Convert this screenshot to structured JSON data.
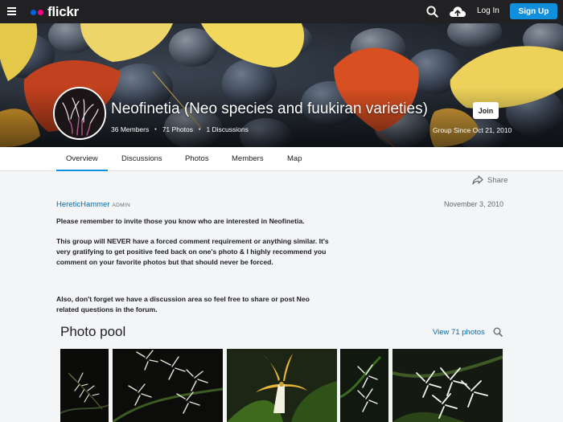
{
  "topbar": {
    "logo_text": "flickr",
    "login_label": "Log In",
    "signup_label": "Sign Up",
    "icons": [
      "menu-icon",
      "search-icon",
      "upload-cloud-icon"
    ]
  },
  "group": {
    "title": "Neofinetia (Neo species and fuukiran varieties)",
    "members": "36 Members",
    "photos": "71 Photos",
    "discussions": "1 Discussions",
    "join_label": "Join",
    "since": "Group Since Oct 21, 2010"
  },
  "tabs": [
    {
      "label": "Overview",
      "active": true
    },
    {
      "label": "Discussions",
      "active": false
    },
    {
      "label": "Photos",
      "active": false
    },
    {
      "label": "Members",
      "active": false
    },
    {
      "label": "Map",
      "active": false
    }
  ],
  "share_label": "Share",
  "post": {
    "author": "HereticHammer",
    "role": "ADMIN",
    "date": "November 3, 2010",
    "paragraphs": [
      "Please remember to invite those you know who are interested in Neofinetia.",
      "This group will NEVER have a forced comment requirement or anything similar. It's very gratifying to get positive feed back on one's photo & I highly recommend you comment on your favorite photos but that should never be forced.",
      "Also, don't forget we have a discussion area so feel free to share or post Neo related questions in the forum."
    ]
  },
  "pool": {
    "title": "Photo pool",
    "view_label": "View 71 photos"
  },
  "colors": {
    "accent": "#128fdc",
    "link": "#006dac",
    "topbar": "#212124",
    "background": "#f3f5f6"
  }
}
